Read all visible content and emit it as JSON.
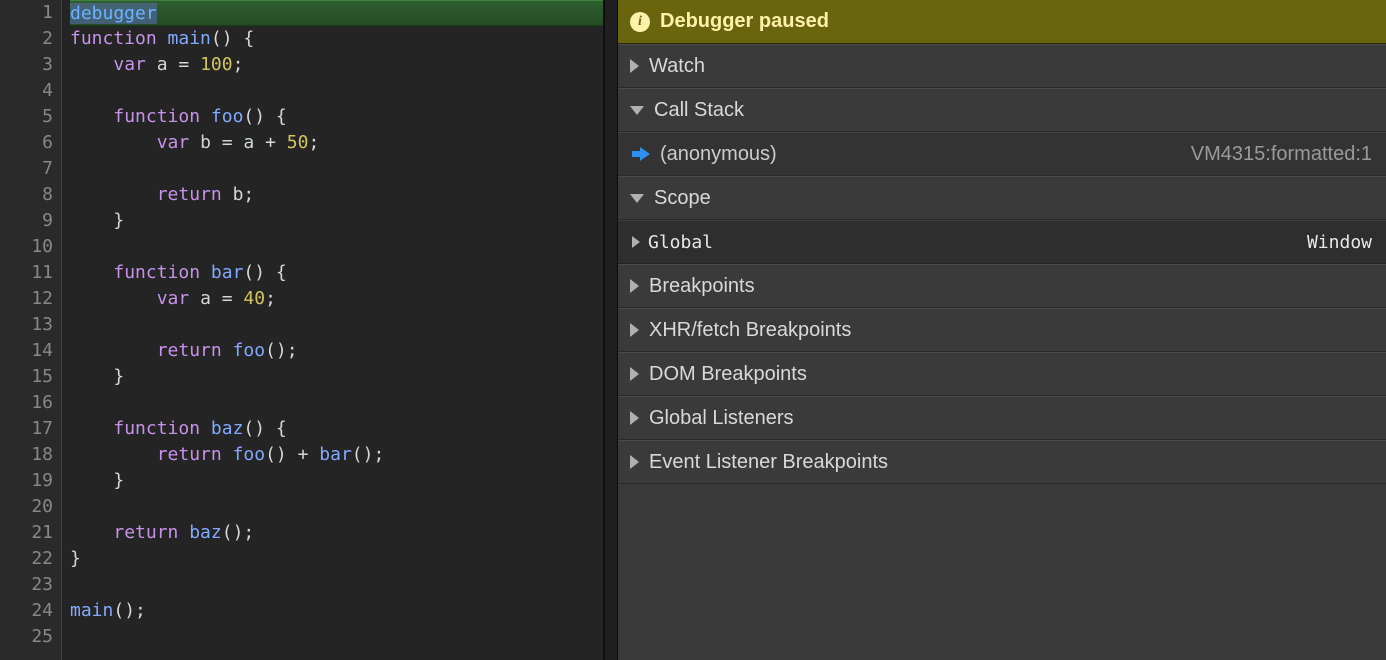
{
  "editor": {
    "execution_line": 1,
    "selection": {
      "line": 1,
      "text": "debugger"
    },
    "lines": [
      {
        "n": 1,
        "tokens": [
          {
            "t": "debugger",
            "c": "tok-dbg sel"
          }
        ]
      },
      {
        "n": 2,
        "tokens": [
          {
            "t": "function ",
            "c": "tok-kw"
          },
          {
            "t": "main",
            "c": "tok-fn"
          },
          {
            "t": "() {",
            "c": "tok-punc"
          }
        ]
      },
      {
        "n": 3,
        "tokens": [
          {
            "t": "    ",
            "c": ""
          },
          {
            "t": "var ",
            "c": "tok-kw"
          },
          {
            "t": "a",
            "c": "tok-var"
          },
          {
            "t": " = ",
            "c": "tok-op"
          },
          {
            "t": "100",
            "c": "tok-num"
          },
          {
            "t": ";",
            "c": "tok-punc"
          }
        ]
      },
      {
        "n": 4,
        "tokens": []
      },
      {
        "n": 5,
        "tokens": [
          {
            "t": "    ",
            "c": ""
          },
          {
            "t": "function ",
            "c": "tok-kw"
          },
          {
            "t": "foo",
            "c": "tok-fn"
          },
          {
            "t": "() {",
            "c": "tok-punc"
          }
        ]
      },
      {
        "n": 6,
        "tokens": [
          {
            "t": "        ",
            "c": ""
          },
          {
            "t": "var ",
            "c": "tok-kw"
          },
          {
            "t": "b",
            "c": "tok-var"
          },
          {
            "t": " = ",
            "c": "tok-op"
          },
          {
            "t": "a",
            "c": "tok-var"
          },
          {
            "t": " + ",
            "c": "tok-op"
          },
          {
            "t": "50",
            "c": "tok-num"
          },
          {
            "t": ";",
            "c": "tok-punc"
          }
        ]
      },
      {
        "n": 7,
        "tokens": []
      },
      {
        "n": 8,
        "tokens": [
          {
            "t": "        ",
            "c": ""
          },
          {
            "t": "return ",
            "c": "tok-kw"
          },
          {
            "t": "b",
            "c": "tok-var"
          },
          {
            "t": ";",
            "c": "tok-punc"
          }
        ]
      },
      {
        "n": 9,
        "tokens": [
          {
            "t": "    }",
            "c": "tok-punc"
          }
        ]
      },
      {
        "n": 10,
        "tokens": []
      },
      {
        "n": 11,
        "tokens": [
          {
            "t": "    ",
            "c": ""
          },
          {
            "t": "function ",
            "c": "tok-kw"
          },
          {
            "t": "bar",
            "c": "tok-fn"
          },
          {
            "t": "() {",
            "c": "tok-punc"
          }
        ]
      },
      {
        "n": 12,
        "tokens": [
          {
            "t": "        ",
            "c": ""
          },
          {
            "t": "var ",
            "c": "tok-kw"
          },
          {
            "t": "a",
            "c": "tok-var"
          },
          {
            "t": " = ",
            "c": "tok-op"
          },
          {
            "t": "40",
            "c": "tok-num"
          },
          {
            "t": ";",
            "c": "tok-punc"
          }
        ]
      },
      {
        "n": 13,
        "tokens": []
      },
      {
        "n": 14,
        "tokens": [
          {
            "t": "        ",
            "c": ""
          },
          {
            "t": "return ",
            "c": "tok-kw"
          },
          {
            "t": "foo",
            "c": "tok-fn"
          },
          {
            "t": "();",
            "c": "tok-punc"
          }
        ]
      },
      {
        "n": 15,
        "tokens": [
          {
            "t": "    }",
            "c": "tok-punc"
          }
        ]
      },
      {
        "n": 16,
        "tokens": []
      },
      {
        "n": 17,
        "tokens": [
          {
            "t": "    ",
            "c": ""
          },
          {
            "t": "function ",
            "c": "tok-kw"
          },
          {
            "t": "baz",
            "c": "tok-fn"
          },
          {
            "t": "() {",
            "c": "tok-punc"
          }
        ]
      },
      {
        "n": 18,
        "tokens": [
          {
            "t": "        ",
            "c": ""
          },
          {
            "t": "return ",
            "c": "tok-kw"
          },
          {
            "t": "foo",
            "c": "tok-fn"
          },
          {
            "t": "() + ",
            "c": "tok-op"
          },
          {
            "t": "bar",
            "c": "tok-fn"
          },
          {
            "t": "();",
            "c": "tok-punc"
          }
        ]
      },
      {
        "n": 19,
        "tokens": [
          {
            "t": "    }",
            "c": "tok-punc"
          }
        ]
      },
      {
        "n": 20,
        "tokens": []
      },
      {
        "n": 21,
        "tokens": [
          {
            "t": "    ",
            "c": ""
          },
          {
            "t": "return ",
            "c": "tok-kw"
          },
          {
            "t": "baz",
            "c": "tok-fn"
          },
          {
            "t": "();",
            "c": "tok-punc"
          }
        ]
      },
      {
        "n": 22,
        "tokens": [
          {
            "t": "}",
            "c": "tok-punc"
          }
        ]
      },
      {
        "n": 23,
        "tokens": []
      },
      {
        "n": 24,
        "tokens": [
          {
            "t": "main",
            "c": "tok-fn"
          },
          {
            "t": "();",
            "c": "tok-punc"
          }
        ]
      },
      {
        "n": 25,
        "tokens": []
      }
    ]
  },
  "debug": {
    "paused_label": "Debugger paused",
    "sections": {
      "watch": {
        "label": "Watch",
        "expanded": false
      },
      "callstack": {
        "label": "Call Stack",
        "expanded": true,
        "frames": [
          {
            "name": "(anonymous)",
            "location": "VM4315:formatted:1",
            "current": true
          }
        ]
      },
      "scope": {
        "label": "Scope",
        "expanded": true,
        "entries": [
          {
            "name": "Global",
            "value": "Window",
            "expanded": false
          }
        ]
      },
      "breakpoints": {
        "label": "Breakpoints",
        "expanded": false
      },
      "xhr": {
        "label": "XHR/fetch Breakpoints",
        "expanded": false
      },
      "dom": {
        "label": "DOM Breakpoints",
        "expanded": false
      },
      "global_listeners": {
        "label": "Global Listeners",
        "expanded": false
      },
      "event_listener_bp": {
        "label": "Event Listener Breakpoints",
        "expanded": false
      }
    }
  }
}
